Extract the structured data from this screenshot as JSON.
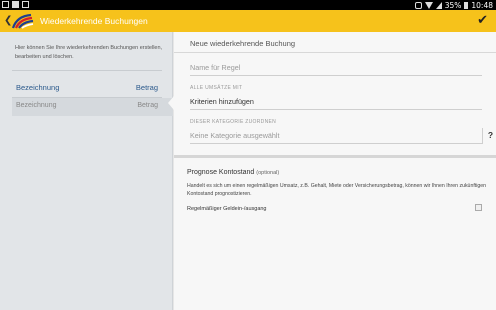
{
  "status_bar": {
    "battery": "35%",
    "time": "10:48"
  },
  "app_bar": {
    "title": "Wiederkehrende Buchungen"
  },
  "left_panel": {
    "description": "Hier können Sie Ihre wiederkehrenden Buchungen erstellen, bearbeiten und löschen.",
    "header": {
      "label": "Bezeichnung",
      "value": "Betrag"
    },
    "selected_row": {
      "label": "Bezeichnung",
      "value": "Betrag"
    }
  },
  "form": {
    "title": "Neue wiederkehrende Buchung",
    "name_placeholder": "Name für Regel",
    "all_transactions_label": "ALLE UMSÄTZE MIT",
    "criteria_value": "Kriterien hinzufügen",
    "category_label": "DIESER KATEGORIE ZUORDNEN",
    "category_value": "Keine Kategorie ausgewählt",
    "help_label": "?"
  },
  "forecast": {
    "title": "Prognose Kontostand",
    "optional": "(optional)",
    "description": "Handelt es sich um einen regelmäßigen Umsatz, z.B. Gehalt, Miete oder Versicherungsbetrag, können wir Ihnen Ihren zukünftigen Kontostand prognostizieren.",
    "checkbox_label": "Regelmäßiger Geldein-/ausgang",
    "checkbox_checked": false
  },
  "colors": {
    "accent": "#f6c21b",
    "link": "#2c5a8c"
  }
}
